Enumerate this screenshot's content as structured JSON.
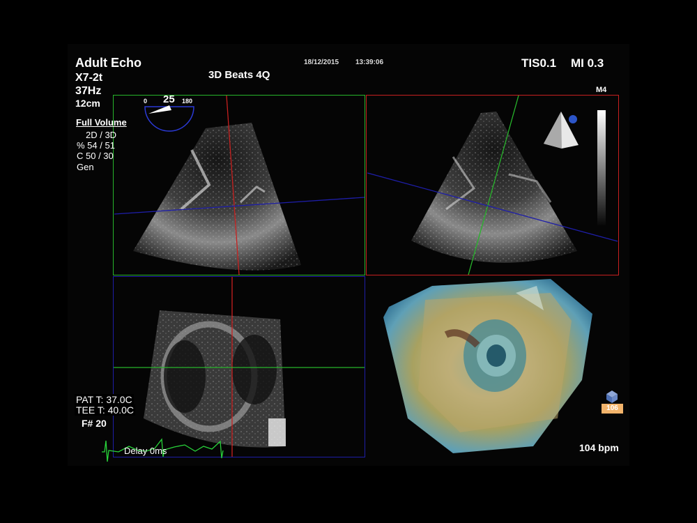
{
  "header": {
    "app_name": "Adult Echo",
    "probe": "X7-2t",
    "frame_rate": "37Hz",
    "depth": "12cm",
    "date": "18/12/2015",
    "time": "13:39:06",
    "mode_title": "3D Beats 4Q",
    "tis": "TIS0.1",
    "mi": "MI 0.3"
  },
  "angle": {
    "min": "0",
    "value": "25",
    "max": "180"
  },
  "params": {
    "acq_mode": "Full Volume",
    "line1": "2D / 3D",
    "line2": "% 54 / 51",
    "line3": "C  50 / 30",
    "line4": "Gen"
  },
  "colormap": {
    "label": "M4"
  },
  "temps": {
    "pat": "PAT T: 37.0C",
    "tee": "TEE T: 40.0C"
  },
  "frame_no": "F# 20",
  "ecg": {
    "delay": "Delay 0ms"
  },
  "volume": {
    "badge": "106",
    "icon": "cube-icon"
  },
  "heart_rate": "104 bpm",
  "colors": {
    "green": "#27b52b",
    "red": "#c8201f",
    "blue": "#1e1ea8",
    "ecg": "#28d43a",
    "badge": "#f3b46b"
  }
}
